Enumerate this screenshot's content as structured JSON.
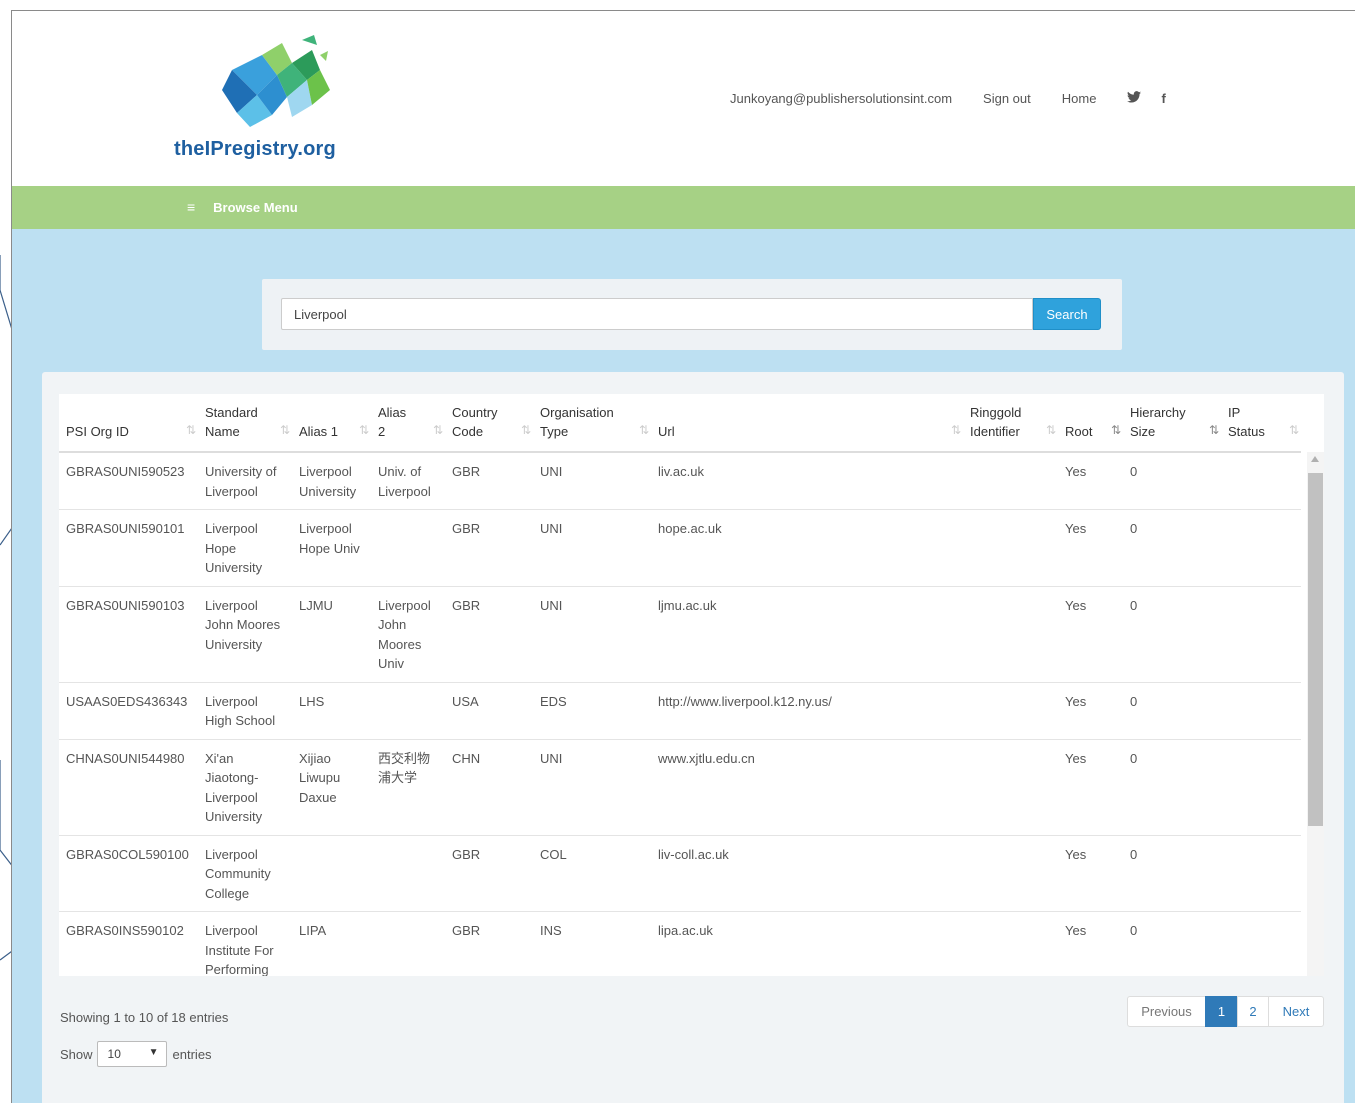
{
  "header": {
    "logo_text": "theIPregistry.org",
    "user_email": "Junkoyang@publishersolutionsint.com",
    "sign_out": "Sign out",
    "home": "Home",
    "twitter_glyph": "🐦",
    "facebook_glyph": "f"
  },
  "menu": {
    "hamburger": "≡",
    "browse_label": "Browse Menu"
  },
  "search": {
    "value": "Liverpool",
    "button": "Search"
  },
  "table": {
    "columns": [
      [
        "PSI Org ID"
      ],
      [
        "Standard",
        "Name"
      ],
      [
        "Alias 1"
      ],
      [
        "Alias",
        "2"
      ],
      [
        "Country",
        "Code"
      ],
      [
        "Organisation",
        "Type"
      ],
      [
        "Url"
      ],
      [
        "Ringgold",
        "Identifier"
      ],
      [
        "Root"
      ],
      [
        "Hierarchy",
        "Size"
      ],
      [
        "IP",
        "Status"
      ]
    ],
    "rows": [
      [
        "GBRAS0UNI590523",
        "University of Liverpool",
        "Liverpool University",
        "Univ. of Liverpool",
        "GBR",
        "UNI",
        "liv.ac.uk",
        "",
        "Yes",
        "0",
        ""
      ],
      [
        "GBRAS0UNI590101",
        "Liverpool Hope University",
        "Liverpool Hope Univ",
        "",
        "GBR",
        "UNI",
        "hope.ac.uk",
        "",
        "Yes",
        "0",
        ""
      ],
      [
        "GBRAS0UNI590103",
        "Liverpool John Moores University",
        "LJMU",
        "Liverpool John Moores Univ",
        "GBR",
        "UNI",
        "ljmu.ac.uk",
        "",
        "Yes",
        "0",
        ""
      ],
      [
        "USAAS0EDS436343",
        "Liverpool High School",
        "LHS",
        "",
        "USA",
        "EDS",
        "http://www.liverpool.k12.ny.us/",
        "",
        "Yes",
        "0",
        ""
      ],
      [
        "CHNAS0UNI544980",
        "Xi'an Jiaotong-Liverpool University",
        "Xijiao Liwupu Daxue",
        "西交利物浦大学",
        "CHN",
        "UNI",
        "www.xjtlu.edu.cn",
        "",
        "Yes",
        "0",
        ""
      ],
      [
        "GBRAS0COL590100",
        "Liverpool Community College",
        "",
        "",
        "GBR",
        "COL",
        "liv-coll.ac.uk",
        "",
        "Yes",
        "0",
        ""
      ],
      [
        "GBRAS0INS590102",
        "Liverpool Institute For Performing Arts",
        "LIPA",
        "",
        "GBR",
        "INS",
        "lipa.ac.uk",
        "",
        "Yes",
        "0",
        ""
      ]
    ]
  },
  "footer": {
    "info": "Showing 1 to 10 of 18 entries",
    "show_label": "Show",
    "show_value": "10",
    "entries_label": "entries",
    "pager": {
      "previous": "Previous",
      "page1": "1",
      "page2": "2",
      "next": "Next"
    }
  }
}
